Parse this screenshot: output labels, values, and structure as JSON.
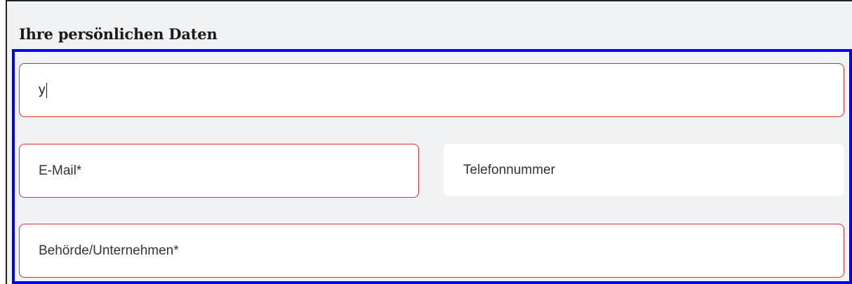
{
  "form": {
    "section_title": "Ihre persönlichen Daten",
    "name_value": "y",
    "email_placeholder": "E-Mail*",
    "phone_placeholder": "Telefonnummer",
    "company_placeholder": "Behörde/Unternehmen*"
  },
  "colors": {
    "panel_background": "#f1f2f4",
    "field_background": "#ffffff",
    "invalid_border": "#e02a2a",
    "highlight_border": "#0000ee"
  }
}
